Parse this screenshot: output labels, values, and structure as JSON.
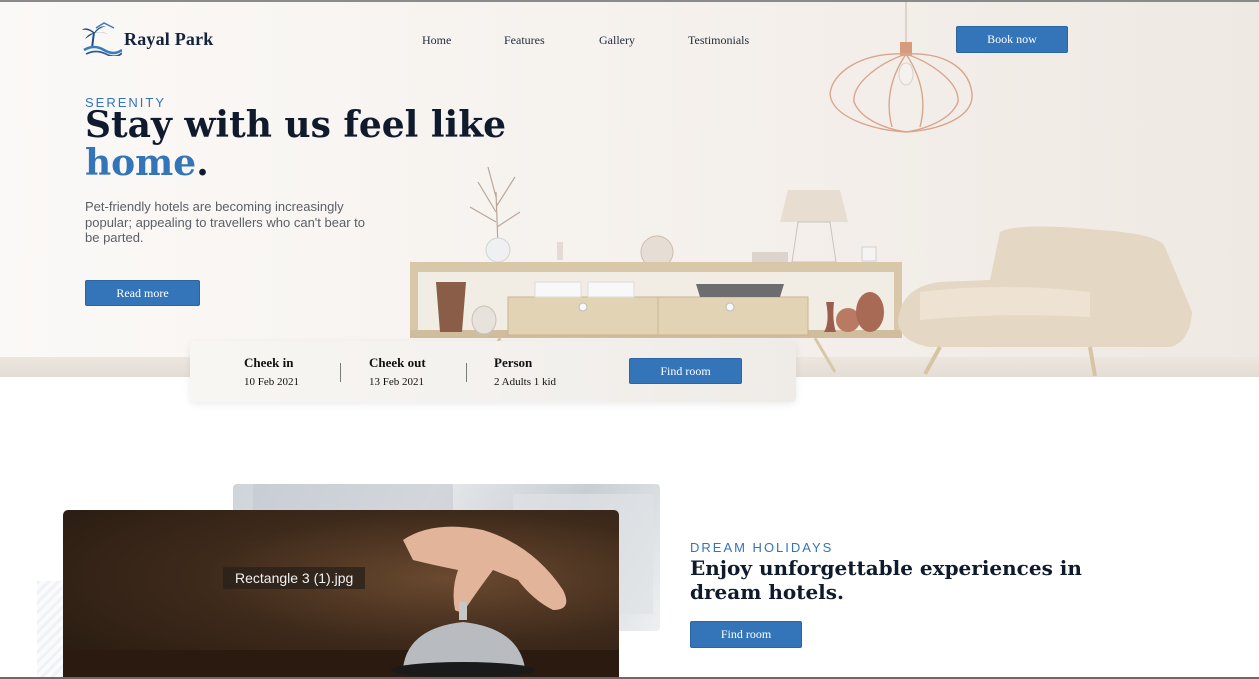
{
  "brand": {
    "name": "Rayal Park",
    "logo_icon": "palm-wave-logo-icon"
  },
  "nav": {
    "items": [
      {
        "label": "Home"
      },
      {
        "label": "Features"
      },
      {
        "label": "Gallery"
      },
      {
        "label": "Testimonials"
      }
    ],
    "cta_label": "Book now"
  },
  "hero": {
    "eyebrow": "SERENITY",
    "headline_part1": "Stay with us feel like ",
    "headline_accent": "home",
    "headline_end": ".",
    "lead": "Pet-friendly hotels are becoming increasingly popular; appealing to travellers who can't bear to be parted.",
    "read_more_label": "Read more"
  },
  "booking": {
    "check_in": {
      "label": "Cheek in",
      "value": "10 Feb 2021"
    },
    "check_out": {
      "label": "Cheek out",
      "value": "13 Feb 2021"
    },
    "person": {
      "label": "Person",
      "value": "2 Adults 1 kid"
    },
    "find_label": "Find room"
  },
  "holidays": {
    "image_label": "Rectangle 3 (1).jpg",
    "eyebrow": "DREAM HOLIDAYS",
    "headline": "Enjoy unforgettable experiences in dream hotels.",
    "find_label": "Find room"
  },
  "colors": {
    "accent": "#3474b8",
    "ink": "#0f1b2d",
    "muted": "#5b5f66"
  }
}
